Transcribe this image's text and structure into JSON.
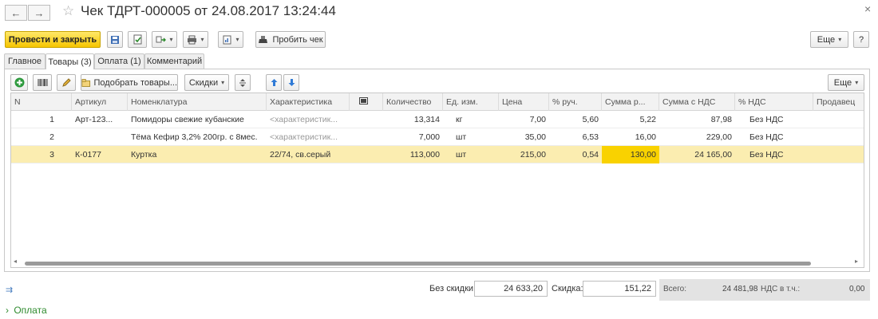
{
  "window": {
    "title": "Чек ТДРТ-000005 от 24.08.2017 13:24:44"
  },
  "toolbar": {
    "post_close": "Провести и закрыть",
    "print_check": "Пробить чек",
    "more": "Еще",
    "help": "?"
  },
  "tabs": [
    {
      "label": "Главное"
    },
    {
      "label": "Товары (3)"
    },
    {
      "label": "Оплата (1)"
    },
    {
      "label": "Комментарий"
    }
  ],
  "table_toolbar": {
    "pick_goods": "Подобрать товары...",
    "discounts": "Скидки",
    "more": "Еще"
  },
  "table": {
    "columns": [
      "N",
      "Артикул",
      "Номенклатура",
      "Характеристика",
      "Количество",
      "Ед. изм.",
      "Цена",
      "% руч.",
      "Сумма р...",
      "Сумма с НДС",
      "% НДС",
      "Продавец"
    ],
    "rows": [
      {
        "n": "1",
        "article": "Арт-123...",
        "name": "Помидоры свежие кубанские",
        "characteristic": "<характеристик...",
        "qty": "13,314",
        "unit": "кг",
        "price": "7,00",
        "pct": "5,60",
        "sum_manual": "5,22",
        "sum_vat": "87,98",
        "vat": "Без НДС",
        "seller": ""
      },
      {
        "n": "2",
        "article": "",
        "name": "Тёма Кефир 3,2% 200гр. с 8мес.",
        "characteristic": "<характеристик...",
        "qty": "7,000",
        "unit": "шт",
        "price": "35,00",
        "pct": "6,53",
        "sum_manual": "16,00",
        "sum_vat": "229,00",
        "vat": "Без НДС",
        "seller": ""
      },
      {
        "n": "3",
        "article": "К-0177",
        "name": "Куртка",
        "characteristic": "22/74, св.серый",
        "qty": "113,000",
        "unit": "шт",
        "price": "215,00",
        "pct": "0,54",
        "sum_manual": "130,00",
        "sum_vat": "24 165,00",
        "vat": "Без НДС",
        "seller": ""
      }
    ]
  },
  "totals": {
    "no_discount_label": "Без скидки:",
    "no_discount_value": "24 633,20",
    "discount_label": "Скидка:",
    "discount_value": "151,22",
    "total_label": "Всего:",
    "total_value": "24 481,98",
    "vat_label": "НДС в т.ч.:",
    "vat_value": "0,00"
  },
  "payment_section": {
    "label": "Оплата"
  },
  "colors": {
    "primary_button": "#f6c500",
    "selected_row": "#fbedb0",
    "highlight_cell": "#f9d200",
    "link_green": "#2e8b2e"
  }
}
